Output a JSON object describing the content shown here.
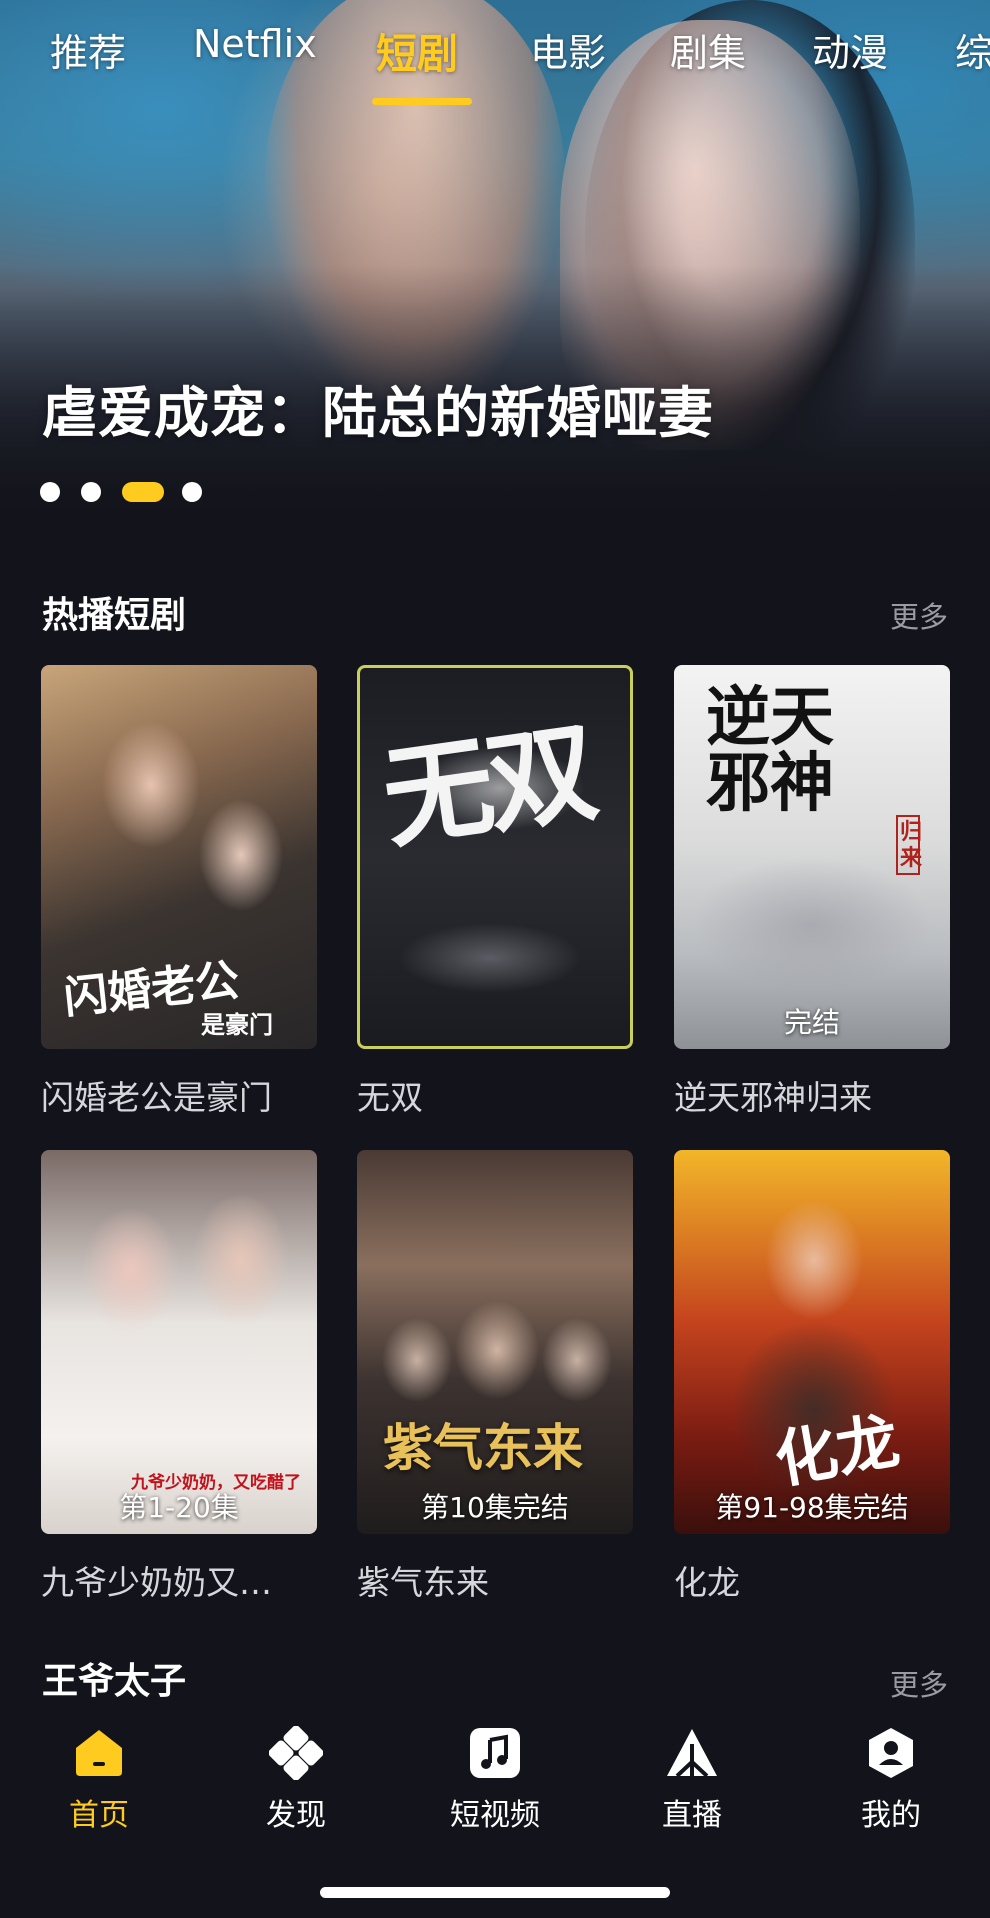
{
  "top_nav": {
    "tabs": [
      "推荐",
      "Netflix",
      "短剧",
      "电影",
      "剧集",
      "动漫",
      "综"
    ],
    "active_tab": "短剧"
  },
  "hero": {
    "title": "虐爱成宠：陆总的新婚哑妻",
    "carousel_count": 4,
    "carousel_active_index": 2
  },
  "sections": [
    {
      "title": "热播短剧",
      "more": "更多",
      "items": [
        {
          "title": "闪婚老公是豪门",
          "badge": "",
          "poster_art": "闪婚老公",
          "poster_art_sub": "是豪门"
        },
        {
          "title": "无双",
          "badge": "",
          "poster_art": "无双",
          "poster_art_sub": ""
        },
        {
          "title": "逆天邪神归来",
          "badge": "完结",
          "poster_art": "逆天邪神",
          "poster_art_sub": "归来"
        },
        {
          "title": "九爷少奶奶又…",
          "badge": "第1-20集",
          "poster_art": "九爷少奶奶，又吃醋了",
          "poster_art_sub": ""
        },
        {
          "title": "紫气东来",
          "badge": "第10集完结",
          "poster_art": "紫气东来",
          "poster_art_sub": ""
        },
        {
          "title": "化龙",
          "badge": "第91-98集完结",
          "poster_art": "化龙",
          "poster_art_sub": ""
        }
      ]
    },
    {
      "title": "王爷太子",
      "more": "更多"
    }
  ],
  "tab_bar": {
    "items": [
      {
        "label": "首页",
        "icon": "home-icon",
        "active": true
      },
      {
        "label": "发现",
        "icon": "discover-icon",
        "active": false
      },
      {
        "label": "短视频",
        "icon": "music-note-icon",
        "active": false
      },
      {
        "label": "直播",
        "icon": "live-icon",
        "active": false
      },
      {
        "label": "我的",
        "icon": "profile-icon",
        "active": false
      }
    ]
  },
  "colors": {
    "accent": "#ffcb1f",
    "background": "#13141b",
    "muted_text": "#9a9ba3"
  }
}
